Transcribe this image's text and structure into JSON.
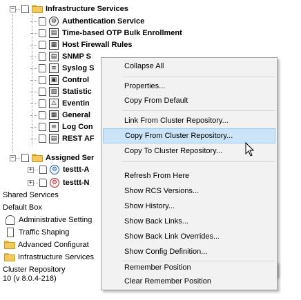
{
  "tree": {
    "infrastructure_services": "Infrastructure Services",
    "children": [
      {
        "label": "Authentication Service",
        "icon": "gear-icon"
      },
      {
        "label": "Time-based OTP Bulk Enrollment",
        "icon": "server-icon"
      },
      {
        "label": "Host Firewall Rules",
        "icon": "firewall-icon"
      },
      {
        "label": "SNMP S",
        "icon": "server-icon"
      },
      {
        "label": "Syslog S",
        "icon": "document-icon"
      },
      {
        "label": "Control",
        "icon": "panel-icon"
      },
      {
        "label": "Statistic",
        "icon": "chart-icon"
      },
      {
        "label": "Eventin",
        "icon": "warning-icon"
      },
      {
        "label": "General",
        "icon": "grid-icon"
      },
      {
        "label": "Log Con",
        "icon": "document-icon"
      },
      {
        "label": "REST AF",
        "icon": "server-icon"
      }
    ],
    "assigned_services": "Assigned Ser",
    "assigned_children": [
      {
        "label": "testtt-A",
        "icon": "user-gear-icon"
      },
      {
        "label": "testtt-N",
        "icon": "user-gear-icon"
      }
    ]
  },
  "lower_panel": {
    "items": [
      {
        "label": "Shared Services",
        "icon": ""
      },
      {
        "label": "Default Box",
        "icon": ""
      },
      {
        "label": "Administrative Setting",
        "icon": "admin-icon"
      },
      {
        "label": "Traffic Shaping",
        "icon": "traffic-icon"
      },
      {
        "label": "Advanced Configurat",
        "icon": "folder-icon"
      },
      {
        "label": "Infrastructure Services",
        "icon": "folder-icon"
      },
      {
        "label": "Cluster Repository",
        "icon": ""
      }
    ],
    "status": "10 (v 8.0.4-218)"
  },
  "context_menu": {
    "items": [
      "Collapse All",
      "Properties...",
      "Copy From Default",
      "Link From Cluster Repository...",
      "Copy From Cluster Repository...",
      "Copy To Cluster Repository...",
      "Refresh From Here",
      "Show RCS Versions...",
      "Show History...",
      "Show Back Links...",
      "Show Back Link Overrides...",
      "Show Config Definition...",
      "Remember Position",
      "Clear Remember Position"
    ],
    "active_index": 4
  }
}
